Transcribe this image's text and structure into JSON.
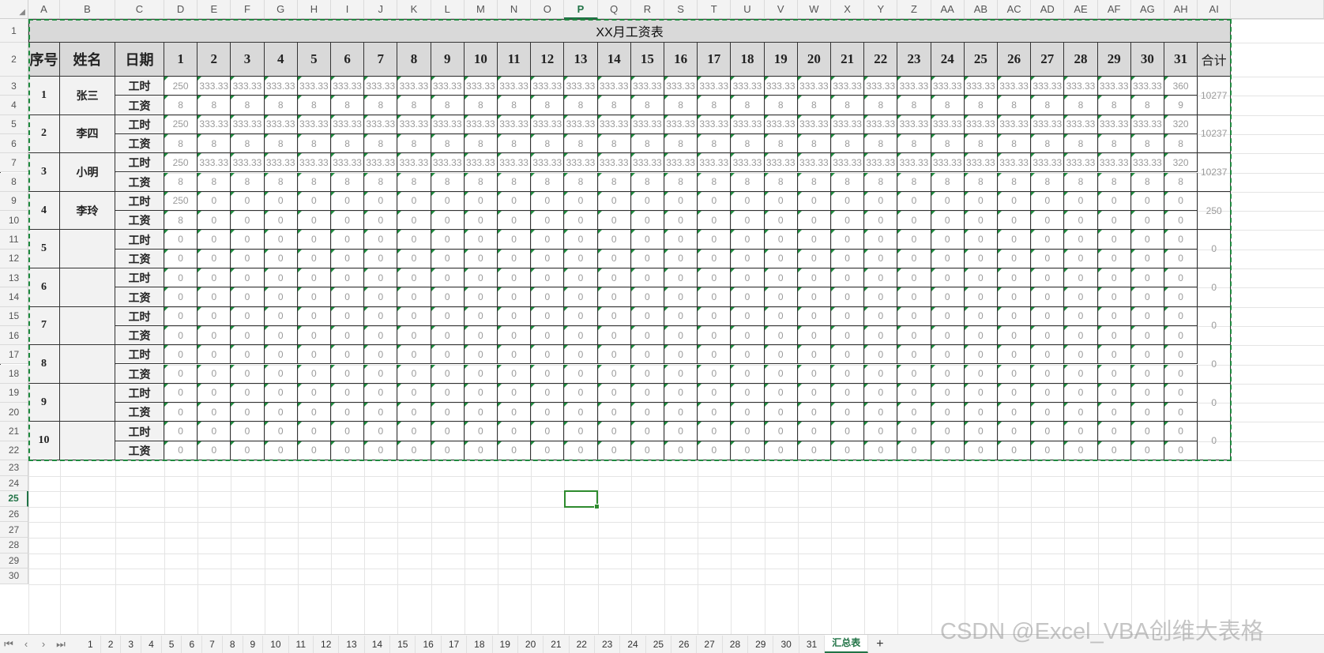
{
  "columns": [
    "A",
    "B",
    "C",
    "D",
    "E",
    "F",
    "G",
    "H",
    "I",
    "J",
    "K",
    "L",
    "M",
    "N",
    "O",
    "P",
    "Q",
    "R",
    "S",
    "T",
    "U",
    "V",
    "W",
    "X",
    "Y",
    "Z",
    "AA",
    "AB",
    "AC",
    "AD",
    "AE",
    "AF",
    "AG",
    "AH",
    "AI"
  ],
  "active_column": "P",
  "rows": [
    "1",
    "2",
    "3",
    "4",
    "5",
    "6",
    "7",
    "8",
    "9",
    "10",
    "11",
    "12",
    "13",
    "14",
    "15",
    "16",
    "17",
    "18",
    "19",
    "20",
    "21",
    "22",
    "23",
    "24",
    "25",
    "26",
    "27",
    "28",
    "29",
    "30"
  ],
  "active_row": "25",
  "table": {
    "title": "XX月工资表",
    "header": {
      "index": "序号",
      "name": "姓名",
      "date": "日期",
      "total": "合计"
    },
    "days": [
      "1",
      "2",
      "3",
      "4",
      "5",
      "6",
      "7",
      "8",
      "9",
      "10",
      "11",
      "12",
      "13",
      "14",
      "15",
      "16",
      "17",
      "18",
      "19",
      "20",
      "21",
      "22",
      "23",
      "24",
      "25",
      "26",
      "27",
      "28",
      "29",
      "30",
      "31"
    ],
    "hours_label": "工时",
    "wage_label": "工资",
    "employees": [
      {
        "index": "1",
        "name": "张三",
        "total": "10277",
        "hours": [
          "250",
          "333.33",
          "333.33",
          "333.33",
          "333.33",
          "333.33",
          "333.33",
          "333.33",
          "333.33",
          "333.33",
          "333.33",
          "333.33",
          "333.33",
          "333.33",
          "333.33",
          "333.33",
          "333.33",
          "333.33",
          "333.33",
          "333.33",
          "333.33",
          "333.33",
          "333.33",
          "333.33",
          "333.33",
          "333.33",
          "333.33",
          "333.33",
          "333.33",
          "333.33",
          "360"
        ],
        "wages": [
          "8",
          "8",
          "8",
          "8",
          "8",
          "8",
          "8",
          "8",
          "8",
          "8",
          "8",
          "8",
          "8",
          "8",
          "8",
          "8",
          "8",
          "8",
          "8",
          "8",
          "8",
          "8",
          "8",
          "8",
          "8",
          "8",
          "8",
          "8",
          "8",
          "8",
          "9"
        ]
      },
      {
        "index": "2",
        "name": "李四",
        "total": "10237",
        "hours": [
          "250",
          "333.33",
          "333.33",
          "333.33",
          "333.33",
          "333.33",
          "333.33",
          "333.33",
          "333.33",
          "333.33",
          "333.33",
          "333.33",
          "333.33",
          "333.33",
          "333.33",
          "333.33",
          "333.33",
          "333.33",
          "333.33",
          "333.33",
          "333.33",
          "333.33",
          "333.33",
          "333.33",
          "333.33",
          "333.33",
          "333.33",
          "333.33",
          "333.33",
          "333.33",
          "320"
        ],
        "wages": [
          "8",
          "8",
          "8",
          "8",
          "8",
          "8",
          "8",
          "8",
          "8",
          "8",
          "8",
          "8",
          "8",
          "8",
          "8",
          "8",
          "8",
          "8",
          "8",
          "8",
          "8",
          "8",
          "8",
          "8",
          "8",
          "8",
          "8",
          "8",
          "8",
          "8",
          "8"
        ]
      },
      {
        "index": "3",
        "name": "小明",
        "total": "10237",
        "hours": [
          "250",
          "333.33",
          "333.33",
          "333.33",
          "333.33",
          "333.33",
          "333.33",
          "333.33",
          "333.33",
          "333.33",
          "333.33",
          "333.33",
          "333.33",
          "333.33",
          "333.33",
          "333.33",
          "333.33",
          "333.33",
          "333.33",
          "333.33",
          "333.33",
          "333.33",
          "333.33",
          "333.33",
          "333.33",
          "333.33",
          "333.33",
          "333.33",
          "333.33",
          "333.33",
          "320"
        ],
        "wages": [
          "8",
          "8",
          "8",
          "8",
          "8",
          "8",
          "8",
          "8",
          "8",
          "8",
          "8",
          "8",
          "8",
          "8",
          "8",
          "8",
          "8",
          "8",
          "8",
          "8",
          "8",
          "8",
          "8",
          "8",
          "8",
          "8",
          "8",
          "8",
          "8",
          "8",
          "8"
        ]
      },
      {
        "index": "4",
        "name": "李玲",
        "total": "250",
        "hours": [
          "250",
          "0",
          "0",
          "0",
          "0",
          "0",
          "0",
          "0",
          "0",
          "0",
          "0",
          "0",
          "0",
          "0",
          "0",
          "0",
          "0",
          "0",
          "0",
          "0",
          "0",
          "0",
          "0",
          "0",
          "0",
          "0",
          "0",
          "0",
          "0",
          "0",
          "0"
        ],
        "wages": [
          "8",
          "0",
          "0",
          "0",
          "0",
          "0",
          "0",
          "0",
          "0",
          "0",
          "0",
          "0",
          "0",
          "0",
          "0",
          "0",
          "0",
          "0",
          "0",
          "0",
          "0",
          "0",
          "0",
          "0",
          "0",
          "0",
          "0",
          "0",
          "0",
          "0",
          "0"
        ]
      },
      {
        "index": "5",
        "name": "",
        "total": "0",
        "hours": [
          "0",
          "0",
          "0",
          "0",
          "0",
          "0",
          "0",
          "0",
          "0",
          "0",
          "0",
          "0",
          "0",
          "0",
          "0",
          "0",
          "0",
          "0",
          "0",
          "0",
          "0",
          "0",
          "0",
          "0",
          "0",
          "0",
          "0",
          "0",
          "0",
          "0",
          "0"
        ],
        "wages": [
          "0",
          "0",
          "0",
          "0",
          "0",
          "0",
          "0",
          "0",
          "0",
          "0",
          "0",
          "0",
          "0",
          "0",
          "0",
          "0",
          "0",
          "0",
          "0",
          "0",
          "0",
          "0",
          "0",
          "0",
          "0",
          "0",
          "0",
          "0",
          "0",
          "0",
          "0"
        ]
      },
      {
        "index": "6",
        "name": "",
        "total": "0",
        "hours": [
          "0",
          "0",
          "0",
          "0",
          "0",
          "0",
          "0",
          "0",
          "0",
          "0",
          "0",
          "0",
          "0",
          "0",
          "0",
          "0",
          "0",
          "0",
          "0",
          "0",
          "0",
          "0",
          "0",
          "0",
          "0",
          "0",
          "0",
          "0",
          "0",
          "0",
          "0"
        ],
        "wages": [
          "0",
          "0",
          "0",
          "0",
          "0",
          "0",
          "0",
          "0",
          "0",
          "0",
          "0",
          "0",
          "0",
          "0",
          "0",
          "0",
          "0",
          "0",
          "0",
          "0",
          "0",
          "0",
          "0",
          "0",
          "0",
          "0",
          "0",
          "0",
          "0",
          "0",
          "0"
        ]
      },
      {
        "index": "7",
        "name": "",
        "total": "0",
        "hours": [
          "0",
          "0",
          "0",
          "0",
          "0",
          "0",
          "0",
          "0",
          "0",
          "0",
          "0",
          "0",
          "0",
          "0",
          "0",
          "0",
          "0",
          "0",
          "0",
          "0",
          "0",
          "0",
          "0",
          "0",
          "0",
          "0",
          "0",
          "0",
          "0",
          "0",
          "0"
        ],
        "wages": [
          "0",
          "0",
          "0",
          "0",
          "0",
          "0",
          "0",
          "0",
          "0",
          "0",
          "0",
          "0",
          "0",
          "0",
          "0",
          "0",
          "0",
          "0",
          "0",
          "0",
          "0",
          "0",
          "0",
          "0",
          "0",
          "0",
          "0",
          "0",
          "0",
          "0",
          "0"
        ]
      },
      {
        "index": "8",
        "name": "",
        "total": "0",
        "hours": [
          "0",
          "0",
          "0",
          "0",
          "0",
          "0",
          "0",
          "0",
          "0",
          "0",
          "0",
          "0",
          "0",
          "0",
          "0",
          "0",
          "0",
          "0",
          "0",
          "0",
          "0",
          "0",
          "0",
          "0",
          "0",
          "0",
          "0",
          "0",
          "0",
          "0",
          "0"
        ],
        "wages": [
          "0",
          "0",
          "0",
          "0",
          "0",
          "0",
          "0",
          "0",
          "0",
          "0",
          "0",
          "0",
          "0",
          "0",
          "0",
          "0",
          "0",
          "0",
          "0",
          "0",
          "0",
          "0",
          "0",
          "0",
          "0",
          "0",
          "0",
          "0",
          "0",
          "0",
          "0"
        ]
      },
      {
        "index": "9",
        "name": "",
        "total": "0",
        "hours": [
          "0",
          "0",
          "0",
          "0",
          "0",
          "0",
          "0",
          "0",
          "0",
          "0",
          "0",
          "0",
          "0",
          "0",
          "0",
          "0",
          "0",
          "0",
          "0",
          "0",
          "0",
          "0",
          "0",
          "0",
          "0",
          "0",
          "0",
          "0",
          "0",
          "0",
          "0"
        ],
        "wages": [
          "0",
          "0",
          "0",
          "0",
          "0",
          "0",
          "0",
          "0",
          "0",
          "0",
          "0",
          "0",
          "0",
          "0",
          "0",
          "0",
          "0",
          "0",
          "0",
          "0",
          "0",
          "0",
          "0",
          "0",
          "0",
          "0",
          "0",
          "0",
          "0",
          "0",
          "0"
        ]
      },
      {
        "index": "10",
        "name": "",
        "total": "0",
        "hours": [
          "0",
          "0",
          "0",
          "0",
          "0",
          "0",
          "0",
          "0",
          "0",
          "0",
          "0",
          "0",
          "0",
          "0",
          "0",
          "0",
          "0",
          "0",
          "0",
          "0",
          "0",
          "0",
          "0",
          "0",
          "0",
          "0",
          "0",
          "0",
          "0",
          "0",
          "0"
        ],
        "wages": [
          "0",
          "0",
          "0",
          "0",
          "0",
          "0",
          "0",
          "0",
          "0",
          "0",
          "0",
          "0",
          "0",
          "0",
          "0",
          "0",
          "0",
          "0",
          "0",
          "0",
          "0",
          "0",
          "0",
          "0",
          "0",
          "0",
          "0",
          "0",
          "0",
          "0",
          "0"
        ]
      }
    ]
  },
  "sheet_tabs": {
    "nav_icons": [
      "first-sheet-icon",
      "prev-sheet-icon",
      "next-sheet-icon",
      "last-sheet-icon"
    ],
    "nav_glyphs": [
      "⏮",
      "‹",
      "›",
      "⏭"
    ],
    "tabs": [
      "1",
      "2",
      "3",
      "4",
      "5",
      "6",
      "7",
      "8",
      "9",
      "10",
      "11",
      "12",
      "13",
      "14",
      "15",
      "16",
      "17",
      "18",
      "19",
      "20",
      "21",
      "22",
      "23",
      "24",
      "25",
      "26",
      "27",
      "28",
      "29",
      "30",
      "31",
      "汇总表"
    ],
    "active_tab": "汇总表",
    "add_label": "+"
  },
  "watermark": "CSDN @Excel_VBA创维大表格",
  "colors": {
    "accent": "#217346",
    "selection": "#1e8a3e",
    "header_fill": "#d9d9d9"
  }
}
